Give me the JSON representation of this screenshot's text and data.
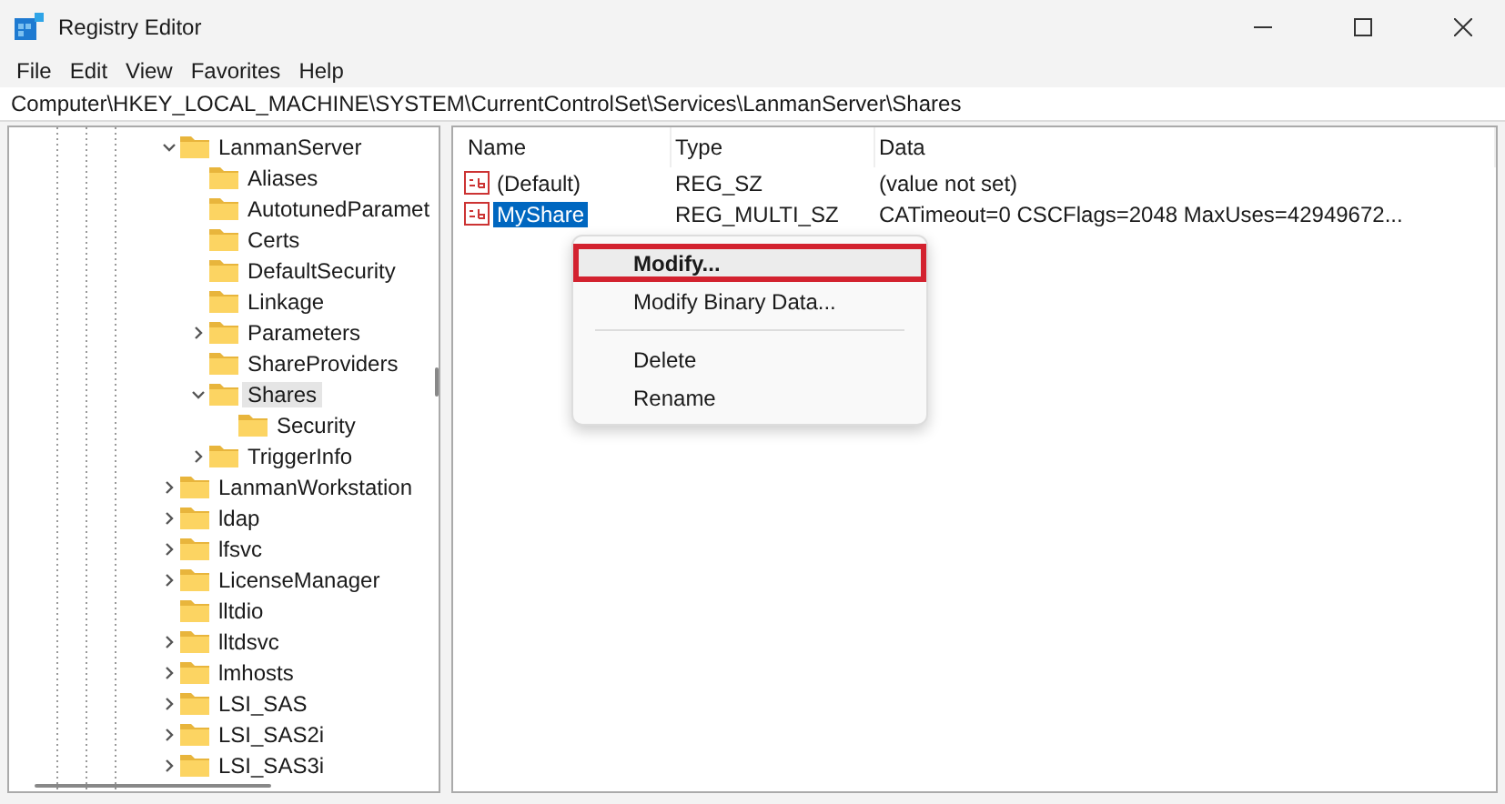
{
  "window": {
    "title": "Registry Editor"
  },
  "menu_bar": [
    "File",
    "Edit",
    "View",
    "Favorites",
    "Help"
  ],
  "address_bar": "Computer\\HKEY_LOCAL_MACHINE\\SYSTEM\\CurrentControlSet\\Services\\LanmanServer\\Shares",
  "tree": [
    {
      "label": "LanmanServer",
      "expanded": true,
      "selected": false,
      "children": [
        {
          "label": "Aliases",
          "selected": false
        },
        {
          "label": "AutotunedParamet",
          "selected": false
        },
        {
          "label": "Certs",
          "selected": false
        },
        {
          "label": "DefaultSecurity",
          "selected": false
        },
        {
          "label": "Linkage",
          "selected": false
        },
        {
          "label": "Parameters",
          "expanded": false,
          "selected": false
        },
        {
          "label": "ShareProviders",
          "selected": false
        },
        {
          "label": "Shares",
          "expanded": true,
          "selected": true,
          "children": [
            {
              "label": "Security",
              "selected": false
            }
          ]
        },
        {
          "label": "TriggerInfo",
          "expanded": false,
          "selected": false
        }
      ]
    },
    {
      "label": "LanmanWorkstation",
      "expanded": false,
      "selected": false
    },
    {
      "label": "ldap",
      "expanded": false,
      "selected": false
    },
    {
      "label": "lfsvc",
      "expanded": false,
      "selected": false
    },
    {
      "label": "LicenseManager",
      "expanded": false,
      "selected": false
    },
    {
      "label": "lltdio",
      "selected": false
    },
    {
      "label": "lltdsvc",
      "expanded": false,
      "selected": false
    },
    {
      "label": "lmhosts",
      "expanded": false,
      "selected": false
    },
    {
      "label": "LSI_SAS",
      "expanded": false,
      "selected": false
    },
    {
      "label": "LSI_SAS2i",
      "expanded": false,
      "selected": false
    },
    {
      "label": "LSI_SAS3i",
      "expanded": false,
      "selected": false
    }
  ],
  "values_table": {
    "columns": [
      "Name",
      "Type",
      "Data"
    ],
    "rows": [
      {
        "name": "(Default)",
        "type": "REG_SZ",
        "data": "(value not set)",
        "selected": false
      },
      {
        "name": "MyShare",
        "type": "REG_MULTI_SZ",
        "data": "CATimeout=0 CSCFlags=2048 MaxUses=42949672...",
        "selected": true
      }
    ]
  },
  "context_menu": [
    {
      "kind": "item",
      "label": "Modify...",
      "selected": true
    },
    {
      "kind": "item",
      "label": "Modify Binary Data...",
      "selected": false
    },
    {
      "kind": "separator"
    },
    {
      "kind": "item",
      "label": "Delete",
      "selected": false
    },
    {
      "kind": "item",
      "label": "Rename",
      "selected": false
    }
  ]
}
